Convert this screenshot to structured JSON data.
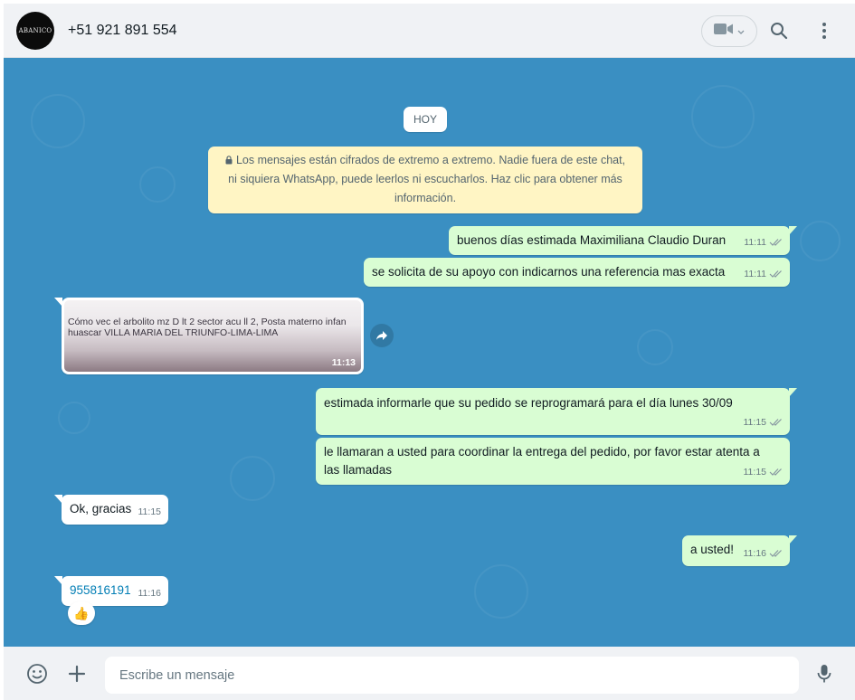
{
  "header": {
    "avatar_text": "ABANICO",
    "contact": "+51 921 891 554",
    "icons": [
      "video-call-icon",
      "chevron-down-icon",
      "search-icon",
      "kebab-menu-icon"
    ]
  },
  "chat": {
    "date_pill": "HOY",
    "encryption_notice": "Los mensajes están cifrados de extremo a extremo. Nadie fuera de este chat, ni siquiera WhatsApp, puede leerlos ni escucharlos. Haz clic para obtener más información.",
    "messages": [
      {
        "dir": "out",
        "text": "buenos días estimada Maximiliana Claudio Duran",
        "time": "11:11"
      },
      {
        "dir": "out",
        "text": "se solicita de su apoyo con indicarnos una referencia mas exacta",
        "time": "11:11"
      },
      {
        "dir": "in",
        "type": "image",
        "image_line1": "Cómo vec el arbolito mz D lt 2 sector acu ll 2,  Posta materno infan",
        "image_line2": "huascar VILLA MARIA DEL TRIUNFO-LIMA-LIMA",
        "time": "11:13"
      },
      {
        "dir": "out",
        "text": "estimada informarle que su pedido se reprogramará para el día lunes 30/09",
        "time": "11:15"
      },
      {
        "dir": "out",
        "text": "le llamaran a usted para coordinar la entrega del pedido, por favor estar atenta a las llamadas",
        "time": "11:15"
      },
      {
        "dir": "in",
        "text": "Ok, gracias",
        "time": "11:15"
      },
      {
        "dir": "out",
        "text": "a usted!",
        "time": "11:16"
      },
      {
        "dir": "in",
        "text": "955816191",
        "time": "11:16",
        "link": true
      }
    ],
    "reaction": "👍"
  },
  "footer": {
    "placeholder": "Escribe un mensaje",
    "icons": [
      "emoji-icon",
      "plus-icon",
      "microphone-icon"
    ]
  },
  "colors": {
    "chat_bg": "#3a8fc2",
    "outgoing": "#d9fdd3",
    "incoming": "#ffffff",
    "notice": "#fff5c4",
    "link": "#027eb5"
  }
}
